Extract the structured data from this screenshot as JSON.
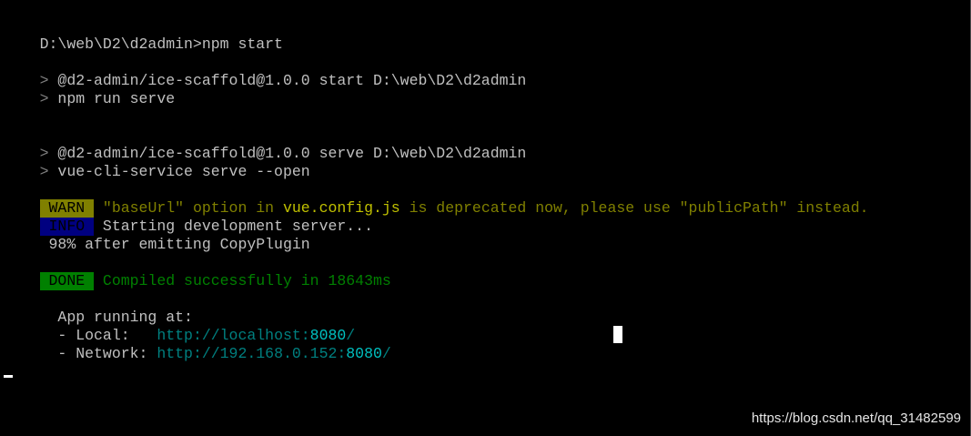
{
  "terminal": {
    "command_line": "D:\\web\\D2\\d2admin>npm start",
    "gt": ">",
    "script1_header": " @d2-admin/ice-scaffold@1.0.0 start D:\\web\\D2\\d2admin",
    "script1_cmd": " npm run serve",
    "script2_header": " @d2-admin/ice-scaffold@1.0.0 serve D:\\web\\D2\\d2admin",
    "script2_cmd": " vue-cli-service serve --open",
    "warn": {
      "badge": " WARN ",
      "text_a": " \"baseUrl\" option in ",
      "file": "vue.config.js",
      "text_b": " is deprecated now, please use \"publicPath\" instead."
    },
    "info": {
      "badge": " INFO ",
      "text": " Starting development server..."
    },
    "progress": " 98% after emitting CopyPlugin",
    "done": {
      "badge": " DONE ",
      "text": " Compiled successfully in 18643ms"
    },
    "app_running": "  App running at:",
    "local": {
      "label": "  - Local:   ",
      "url_prefix": "http://localhost:",
      "port": "8080",
      "url_suffix": "/"
    },
    "network": {
      "label": "  - Network: ",
      "url_prefix": "http://192.168.0.152:",
      "port": "8080",
      "url_suffix": "/"
    }
  },
  "watermark": "https://blog.csdn.net/qq_31482599",
  "colors": {
    "background": "#000000",
    "text": "#c0c0c0",
    "warn": "#808000",
    "info": "#000080",
    "done": "#008000",
    "url": "#008080",
    "port": "#00c0c0"
  }
}
